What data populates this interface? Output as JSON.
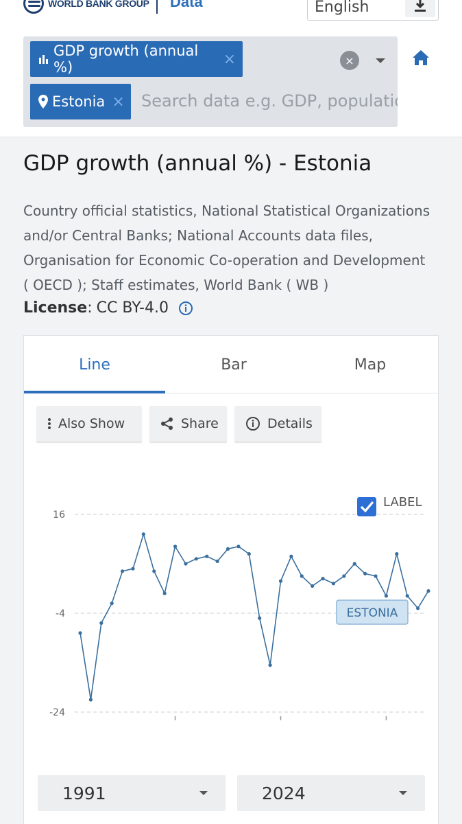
{
  "header": {
    "brand_name": "WORLD BANK GROUP",
    "brand_section": "Data",
    "language": "English"
  },
  "search": {
    "indicator_chip": "GDP growth (annual %)",
    "country_chip": "Estonia",
    "placeholder": "Search data e.g. GDP, population,",
    "chip_close": "×",
    "clear": "×"
  },
  "page": {
    "title": "GDP growth (annual %) - Estonia",
    "source": "Country official statistics, National Statistical Organizations and/or Central Banks; National Accounts data files, Organisation for Economic Co-operation and Development ( OECD ); Staff estimates, World Bank ( WB )",
    "license_key": "License",
    "license_sep": " :",
    "license_value": "CC BY-4.0"
  },
  "tabs": [
    {
      "label": "Line",
      "active": true
    },
    {
      "label": "Bar",
      "active": false
    },
    {
      "label": "Map",
      "active": false
    }
  ],
  "actions": {
    "also_show": "Also Show",
    "share": "Share",
    "details": "Details"
  },
  "chart_data": {
    "type": "line",
    "label_toggle": "LABEL",
    "label_checked": true,
    "series": [
      {
        "name": "ESTONIA",
        "color": "#3a6f9e",
        "x": [
          1991,
          1992,
          1993,
          1994,
          1995,
          1996,
          1997,
          1998,
          1999,
          2000,
          2001,
          2002,
          2003,
          2004,
          2005,
          2006,
          2007,
          2008,
          2009,
          2010,
          2011,
          2012,
          2013,
          2014,
          2015,
          2016,
          2017,
          2018,
          2019,
          2020,
          2021,
          2022,
          2023,
          2024
        ],
        "values": [
          -8.0,
          -21.5,
          -6.0,
          -2.0,
          4.5,
          5.0,
          12.0,
          4.5,
          0.0,
          9.5,
          6.0,
          7.0,
          7.5,
          6.5,
          9.0,
          9.5,
          8.0,
          -5.0,
          -14.5,
          2.5,
          7.5,
          3.5,
          1.5,
          3.0,
          2.0,
          3.5,
          6.0,
          4.0,
          3.5,
          -0.5,
          8.0,
          -0.5,
          -3.0,
          0.5
        ]
      }
    ],
    "y_ticks": [
      16,
      -4,
      -24
    ],
    "ylim": [
      -24,
      16
    ],
    "xlim": [
      1991,
      2024
    ],
    "grid": true,
    "start_year": "1991",
    "end_year": "2024"
  }
}
